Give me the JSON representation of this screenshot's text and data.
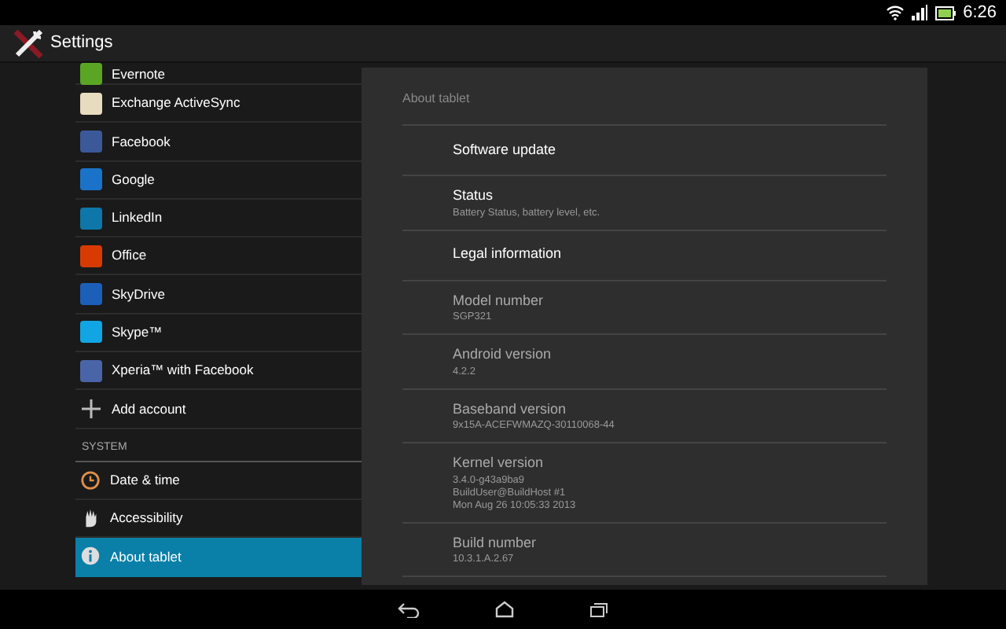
{
  "status_bar": {
    "time": "6:26"
  },
  "action_bar": {
    "title": "Settings"
  },
  "sidebar": {
    "items": [
      {
        "kind": "account",
        "label": "Evernote",
        "color": "#5ba525",
        "selected": false,
        "partial": true
      },
      {
        "kind": "account",
        "label": "Exchange ActiveSync",
        "color": "#e8dcc0",
        "selected": false
      },
      {
        "kind": "account",
        "label": "Facebook",
        "color": "#3b5998",
        "selected": false
      },
      {
        "kind": "account",
        "label": "Google",
        "color": "#1a73c8",
        "selected": false
      },
      {
        "kind": "account",
        "label": "LinkedIn",
        "color": "#0e76a8",
        "selected": false
      },
      {
        "kind": "account",
        "label": "Office",
        "color": "#d83b01",
        "selected": false
      },
      {
        "kind": "account",
        "label": "SkyDrive",
        "color": "#1c5fb8",
        "selected": false
      },
      {
        "kind": "account",
        "label": "Skype™",
        "color": "#12a5e4",
        "selected": false
      },
      {
        "kind": "account",
        "label": "Xperia™ with Facebook",
        "color": "#4a64a8",
        "selected": false
      },
      {
        "kind": "add",
        "label": "Add account",
        "selected": false
      },
      {
        "kind": "header",
        "label": "SYSTEM"
      },
      {
        "kind": "clock",
        "label": "Date & time",
        "selected": false
      },
      {
        "kind": "hand",
        "label": "Accessibility",
        "selected": false
      },
      {
        "kind": "info",
        "label": "About tablet",
        "selected": true
      }
    ]
  },
  "detail": {
    "title": "About tablet",
    "rows": [
      {
        "title": "Software update",
        "disabled": false
      },
      {
        "title": "Status",
        "summary": [
          "Battery Status, battery level, etc."
        ],
        "disabled": false
      },
      {
        "title": "Legal information",
        "disabled": false
      },
      {
        "title": "Model number",
        "summary": [
          "SGP321"
        ],
        "disabled": true
      },
      {
        "title": "Android version",
        "summary": [
          "4.2.2"
        ],
        "disabled": true
      },
      {
        "title": "Baseband version",
        "summary": [
          "9x15A-ACEFWMAZQ-30110068-44"
        ],
        "disabled": true
      },
      {
        "title": "Kernel version",
        "summary": [
          "3.4.0-g43a9ba9",
          "BuildUser@BuildHost #1",
          "Mon Aug 26 10:05:33 2013"
        ],
        "disabled": true
      },
      {
        "title": "Build number",
        "summary": [
          "10.3.1.A.2.67"
        ],
        "disabled": true
      }
    ]
  }
}
